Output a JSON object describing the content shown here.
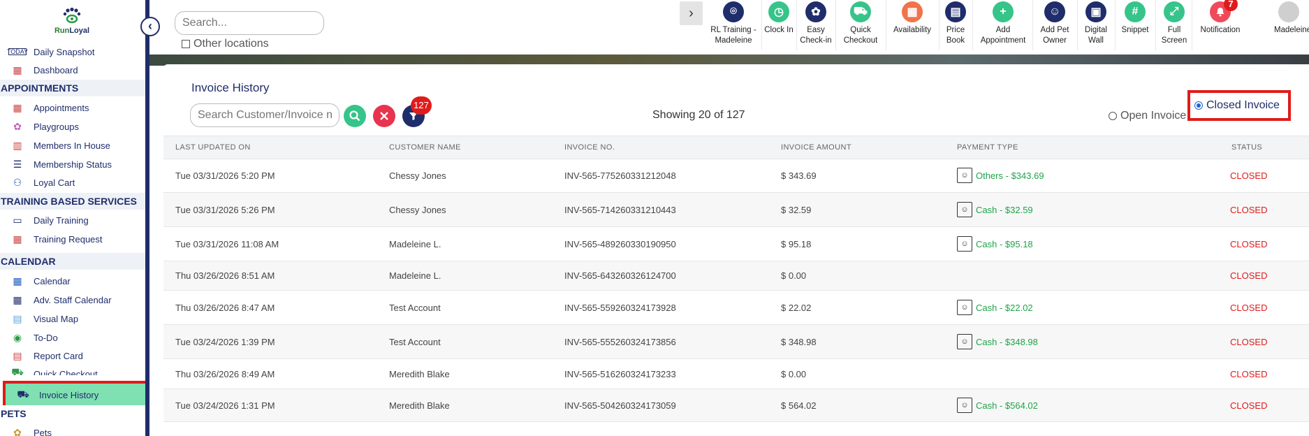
{
  "sidebar": {
    "logo_text_a": "Run",
    "logo_text_b": "Loyal",
    "collapse_glyph": "‹",
    "items": [
      {
        "label": "Daily Snapshot",
        "icon": "today-icon",
        "glyph": "▭"
      },
      {
        "label": "Dashboard",
        "icon": "dashboard-icon",
        "glyph": "▦"
      },
      {
        "label": "Appointments",
        "icon": "calendar-grid-icon",
        "glyph": "▦"
      },
      {
        "label": "Playgroups",
        "icon": "playgroups-icon",
        "glyph": "✿"
      },
      {
        "label": "Members In House",
        "icon": "members-icon",
        "glyph": "▥"
      },
      {
        "label": "Membership Status",
        "icon": "membership-icon",
        "glyph": "☰"
      },
      {
        "label": "Loyal Cart",
        "icon": "cart-icon",
        "glyph": "⚇"
      },
      {
        "label": "Daily Training",
        "icon": "training-icon",
        "glyph": "▭"
      },
      {
        "label": "Training Request",
        "icon": "training-request-icon",
        "glyph": "▦"
      },
      {
        "label": "Calendar",
        "icon": "calendar-icon",
        "glyph": "▦"
      },
      {
        "label": "Adv. Staff Calendar",
        "icon": "staff-calendar-icon",
        "glyph": "▦"
      },
      {
        "label": "Visual Map",
        "icon": "map-icon",
        "glyph": "▤"
      },
      {
        "label": "To-Do",
        "icon": "todo-icon",
        "glyph": "◉"
      },
      {
        "label": "Report Card",
        "icon": "report-card-icon",
        "glyph": "▤"
      },
      {
        "label": "Quick Checkout",
        "icon": "quick-checkout-icon",
        "glyph": "⛟"
      },
      {
        "label": "Invoice History",
        "icon": "invoice-history-icon",
        "glyph": "⛟"
      },
      {
        "label": "Pets",
        "icon": "pets-icon",
        "glyph": "✿"
      }
    ],
    "sections": {
      "appointments": "APPOINTMENTS",
      "training": "TRAINING BASED SERVICES",
      "calendar": "CALENDAR",
      "pets": "PETS"
    }
  },
  "topbar": {
    "search_placeholder": "Search...",
    "other_locations": "Other locations",
    "expand_glyph": "›",
    "tools": [
      {
        "label": "RL Training - Madeleine",
        "icon": "location-pin-icon",
        "color": "#1f2d6b",
        "glyph": "⌾"
      },
      {
        "label": "Clock In",
        "icon": "clock-icon",
        "color": "#36c48a",
        "glyph": "◷"
      },
      {
        "label": "Easy Check-in",
        "icon": "paw-icon",
        "color": "#1f2d6b",
        "glyph": "✿"
      },
      {
        "label": "Quick Checkout",
        "icon": "checkout-cart-icon",
        "color": "#36c48a",
        "glyph": "⛟"
      },
      {
        "label": "Availability",
        "icon": "availability-icon",
        "color": "#f0734a",
        "glyph": "▦"
      },
      {
        "label": "Price Book",
        "icon": "price-book-icon",
        "color": "#1f2d6b",
        "glyph": "▤"
      },
      {
        "label": "Add Appointment",
        "icon": "add-appointment-icon",
        "color": "#36c48a",
        "glyph": "+"
      },
      {
        "label": "Add Pet Owner",
        "icon": "add-user-icon",
        "color": "#1f2d6b",
        "glyph": "☺"
      },
      {
        "label": "Digital Wall",
        "icon": "digital-wall-icon",
        "color": "#1f2d6b",
        "glyph": "▣"
      },
      {
        "label": "Snippet",
        "icon": "hashtag-icon",
        "color": "#36c48a",
        "glyph": "#"
      },
      {
        "label": "Full Screen",
        "icon": "fullscreen-icon",
        "color": "#36c48a",
        "glyph": "⤢"
      },
      {
        "label": "Notification",
        "icon": "bell-icon",
        "color": "#f04a5a",
        "glyph": "🔔",
        "badge": "7"
      },
      {
        "label": "Madeleine",
        "icon": "avatar-icon",
        "color": "#cfcfcf",
        "glyph": "●"
      }
    ]
  },
  "invoice": {
    "title": "Invoice History",
    "search_placeholder": "Search Customer/Invoice n",
    "filter_count": "127",
    "showing": "Showing 20 of 127",
    "open_label": "Open Invoice",
    "closed_label": "Closed Invoice",
    "columns": [
      "LAST UPDATED ON",
      "CUSTOMER NAME",
      "INVOICE NO.",
      "INVOICE AMOUNT",
      "PAYMENT TYPE",
      "STATUS"
    ],
    "rows": [
      {
        "date": "Tue 03/31/2026 5:20 PM",
        "customer": "Chessy Jones",
        "invoice_no": "INV-565-775260331212048",
        "amount": "$ 343.69",
        "payment": "Others - $343.69",
        "status": "CLOSED"
      },
      {
        "date": "Tue 03/31/2026 5:26 PM",
        "customer": "Chessy Jones",
        "invoice_no": "INV-565-714260331210443",
        "amount": "$ 32.59",
        "payment": "Cash - $32.59",
        "status": "CLOSED"
      },
      {
        "date": "Tue 03/31/2026 11:08 AM",
        "customer": "Madeleine L.",
        "invoice_no": "INV-565-489260330190950",
        "amount": "$ 95.18",
        "payment": "Cash - $95.18",
        "status": "CLOSED"
      },
      {
        "date": "Thu 03/26/2026 8:51 AM",
        "customer": "Madeleine L.",
        "invoice_no": "INV-565-643260326124700",
        "amount": "$ 0.00",
        "payment": "",
        "status": "CLOSED"
      },
      {
        "date": "Thu 03/26/2026 8:47 AM",
        "customer": "Test Account",
        "invoice_no": "INV-565-559260324173928",
        "amount": "$ 22.02",
        "payment": "Cash - $22.02",
        "status": "CLOSED"
      },
      {
        "date": "Tue 03/24/2026 1:39 PM",
        "customer": "Test Account",
        "invoice_no": "INV-565-555260324173856",
        "amount": "$ 348.98",
        "payment": "Cash - $348.98",
        "status": "CLOSED"
      },
      {
        "date": "Thu 03/26/2026 8:49 AM",
        "customer": "Meredith Blake",
        "invoice_no": "INV-565-516260324173233",
        "amount": "$ 0.00",
        "payment": "",
        "status": "CLOSED"
      },
      {
        "date": "Tue 03/24/2026 1:31 PM",
        "customer": "Meredith Blake",
        "invoice_no": "INV-565-504260324173059",
        "amount": "$ 564.02",
        "payment": "Cash - $564.02",
        "status": "CLOSED"
      }
    ]
  }
}
